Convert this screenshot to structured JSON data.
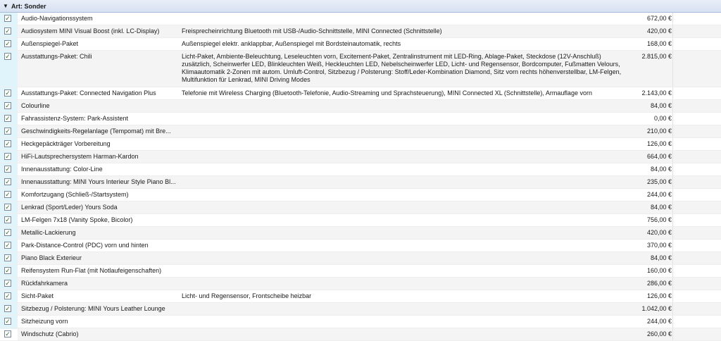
{
  "group": {
    "label": "Art: Sonder",
    "chevron_icon": "chevron-down-icon"
  },
  "rows": [
    {
      "name": "Audio-Navigationssystem",
      "description": "",
      "price": "672,00 €",
      "checked": true
    },
    {
      "name": "Audiosystem MINI Visual Boost (inkl. LC-Display)",
      "description": "Freisprecheinrichtung Bluetooth mit USB-/Audio-Schnittstelle, MINI Connected (Schnittstelle)",
      "price": "420,00 €",
      "checked": true
    },
    {
      "name": "Außenspiegel-Paket",
      "description": "Außenspiegel elektr. anklappbar, Außenspiegel mit Bordsteinautomatik, rechts",
      "price": "168,00 €",
      "checked": true
    },
    {
      "name": "Ausstattungs-Paket: Chili",
      "description": "Licht-Paket, Ambiente-Beleuchtung, Leseleuchten vorn, Excitement-Paket, Zentralinstrument mit LED-Ring, Ablage-Paket, Steckdose (12V-Anschluß) zusätzlich, Scheinwerfer LED, Blinkleuchten Weiß, Heckleuchten LED, Nebelscheinwerfer LED, Licht- und Regensensor, Bordcomputer, Fußmatten Velours, Klimaautomatik 2-Zonen mit autom. Umluft-Control, Sitzbezug / Polsterung: Stoff/Leder-Kombination Diamond, Sitz vorn rechts höhenverstellbar, LM-Felgen, Multifunktion für Lenkrad, MINI Driving Modes",
      "price": "2.815,00 €",
      "checked": true
    },
    {
      "name": "Ausstattungs-Paket: Connected Navigation Plus",
      "description": "Telefonie mit Wireless Charging (Bluetooth-Telefonie, Audio-Streaming und Sprachsteuerung), MINI Connected XL (Schnittstelle), Armauflage vorn",
      "price": "2.143,00 €",
      "checked": true
    },
    {
      "name": "Colourline",
      "description": "",
      "price": "84,00 €",
      "checked": true
    },
    {
      "name": "Fahrassistenz-System: Park-Assistent",
      "description": "",
      "price": "0,00 €",
      "checked": true
    },
    {
      "name": "Geschwindigkeits-Regelanlage (Tempomat) mit Bre...",
      "description": "",
      "price": "210,00 €",
      "checked": true
    },
    {
      "name": "Heckgepäckträger Vorbereitung",
      "description": "",
      "price": "126,00 €",
      "checked": true
    },
    {
      "name": "HiFi-Lautsprechersystem Harman-Kardon",
      "description": "",
      "price": "664,00 €",
      "checked": true
    },
    {
      "name": "Innenausstattung: Color-Line",
      "description": "",
      "price": "84,00 €",
      "checked": true
    },
    {
      "name": "Innenausstattung: MINI Yours Interieur Style Piano Bl...",
      "description": "",
      "price": "235,00 €",
      "checked": true
    },
    {
      "name": "Komfortzugang (Schließ-/Startsystem)",
      "description": "",
      "price": "244,00 €",
      "checked": true
    },
    {
      "name": "Lenkrad (Sport/Leder) Yours Soda",
      "description": "",
      "price": "84,00 €",
      "checked": true
    },
    {
      "name": "LM-Felgen 7x18 (Vanity Spoke, Bicolor)",
      "description": "",
      "price": "756,00 €",
      "checked": true
    },
    {
      "name": "Metallic-Lackierung",
      "description": "",
      "price": "420,00 €",
      "checked": true
    },
    {
      "name": "Park-Distance-Control (PDC) vorn und hinten",
      "description": "",
      "price": "370,00 €",
      "checked": true
    },
    {
      "name": "Piano Black Exterieur",
      "description": "",
      "price": "84,00 €",
      "checked": true
    },
    {
      "name": "Reifensystem Run-Flat (mit Notlaufeigenschaften)",
      "description": "",
      "price": "160,00 €",
      "checked": true
    },
    {
      "name": "Rückfahrkamera",
      "description": "",
      "price": "286,00 €",
      "checked": true
    },
    {
      "name": "Sicht-Paket",
      "description": "Licht- und Regensensor, Frontscheibe heizbar",
      "price": "126,00 €",
      "checked": true
    },
    {
      "name": "Sitzbezug / Polsterung: MINI Yours Leather Lounge",
      "description": "",
      "price": "1.042,00 €",
      "checked": true
    },
    {
      "name": "Sitzheizung vorn",
      "description": "",
      "price": "244,00 €",
      "checked": true
    },
    {
      "name": "Windschutz (Cabrio)",
      "description": "",
      "price": "260,00 €",
      "checked": true
    }
  ]
}
